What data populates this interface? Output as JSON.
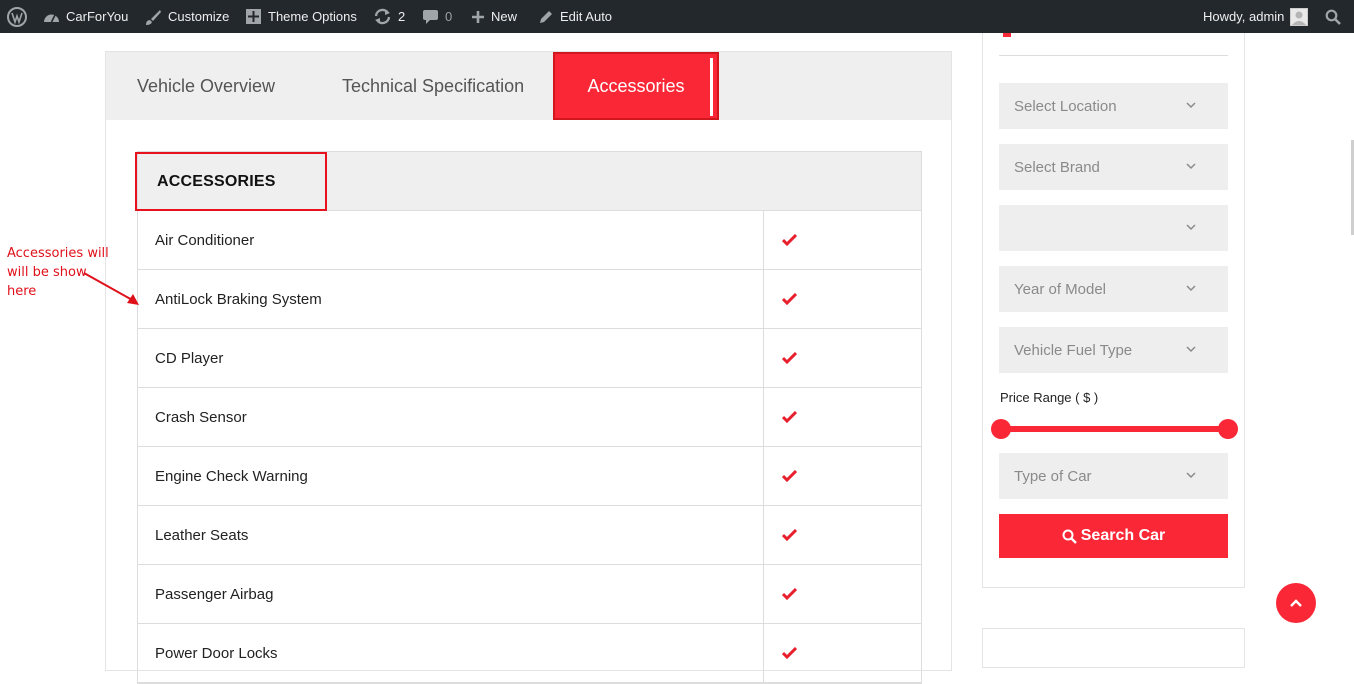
{
  "adminbar": {
    "site_name": "CarForYou",
    "customize": "Customize",
    "theme_options": "Theme Options",
    "updates_count": "2",
    "comments_count": "0",
    "new_label": "New",
    "edit_label": "Edit Auto",
    "greeting": "Howdy, admin"
  },
  "tabs": [
    {
      "label": "Vehicle Overview"
    },
    {
      "label": "Technical Specification"
    },
    {
      "label": "Accessories"
    }
  ],
  "accessories_table": {
    "heading": "ACCESSORIES",
    "rows": [
      {
        "name": "Air Conditioner"
      },
      {
        "name": "AntiLock Braking System"
      },
      {
        "name": "CD Player"
      },
      {
        "name": "Crash Sensor"
      },
      {
        "name": "Engine Check Warning"
      },
      {
        "name": "Leather Seats"
      },
      {
        "name": "Passenger Airbag"
      },
      {
        "name": "Power Door Locks"
      }
    ]
  },
  "annotation": {
    "line1": "Accessories will",
    "line2": "will be show",
    "line3": "here"
  },
  "sidebar": {
    "selects": [
      {
        "label": "Select Location"
      },
      {
        "label": "Select Brand"
      },
      {
        "label": ""
      },
      {
        "label": "Year of Model"
      },
      {
        "label": "Vehicle Fuel Type"
      }
    ],
    "price_range_label": "Price Range ( $ )",
    "type_select": "Type of Car",
    "search_button": "Search Car"
  },
  "colors": {
    "accent": "#fa2837",
    "adminbar": "#23282d",
    "annotation": "#e0101a"
  }
}
